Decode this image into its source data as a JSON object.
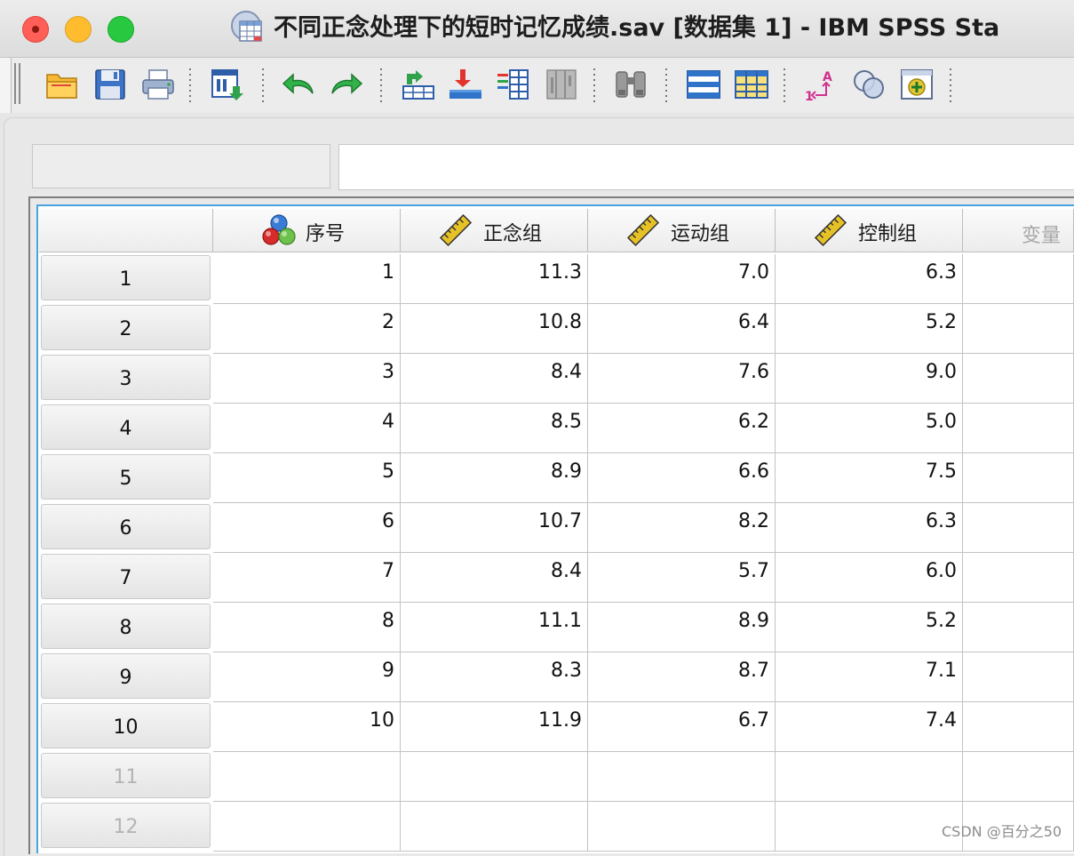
{
  "window": {
    "title": "不同正念处理下的短时记忆成绩.sav [数据集 1] - IBM SPSS Sta"
  },
  "toolbar": {
    "buttons": [
      {
        "name": "open-data-button",
        "icon": "folder-open-icon"
      },
      {
        "name": "save-button",
        "icon": "floppy-icon"
      },
      {
        "name": "print-button",
        "icon": "printer-icon"
      },
      {
        "name": "recall-dialog-button",
        "icon": "dialog-recall-icon"
      },
      {
        "name": "undo-button",
        "icon": "undo-arrow-icon"
      },
      {
        "name": "redo-button",
        "icon": "redo-arrow-icon"
      },
      {
        "name": "goto-case-button",
        "icon": "goto-case-icon"
      },
      {
        "name": "goto-variable-button",
        "icon": "goto-variable-icon"
      },
      {
        "name": "variables-button",
        "icon": "variables-list-icon"
      },
      {
        "name": "run-descriptives-button",
        "icon": "descriptives-icon"
      },
      {
        "name": "find-button",
        "icon": "binoculars-icon"
      },
      {
        "name": "insert-cases-button",
        "icon": "insert-cases-icon"
      },
      {
        "name": "insert-variable-button",
        "icon": "insert-variable-icon"
      },
      {
        "name": "value-labels-button",
        "icon": "value-labels-icon"
      },
      {
        "name": "use-sets-button",
        "icon": "variable-sets-icon"
      },
      {
        "name": "show-all-variables-button",
        "icon": "show-variables-icon"
      }
    ]
  },
  "colors": {
    "accent_blue": "#4aa3df",
    "scale_ruler": "#e7c227",
    "nominal_red": "#d62b2b",
    "nominal_blue": "#3a7bd5",
    "nominal_green": "#6cc24a"
  },
  "grid": {
    "columns": [
      {
        "label": "序号",
        "measure_icon": "nominal-measure-icon"
      },
      {
        "label": "正念组",
        "measure_icon": "scale-ruler-icon"
      },
      {
        "label": "运动组",
        "measure_icon": "scale-ruler-icon"
      },
      {
        "label": "控制组",
        "measure_icon": "scale-ruler-icon"
      },
      {
        "label": "变量",
        "measure_icon": ""
      }
    ],
    "rows": [
      {
        "num": "1",
        "cells": [
          "1",
          "11.3",
          "7.0",
          "6.3",
          ""
        ]
      },
      {
        "num": "2",
        "cells": [
          "2",
          "10.8",
          "6.4",
          "5.2",
          ""
        ]
      },
      {
        "num": "3",
        "cells": [
          "3",
          "8.4",
          "7.6",
          "9.0",
          ""
        ]
      },
      {
        "num": "4",
        "cells": [
          "4",
          "8.5",
          "6.2",
          "5.0",
          ""
        ]
      },
      {
        "num": "5",
        "cells": [
          "5",
          "8.9",
          "6.6",
          "7.5",
          ""
        ]
      },
      {
        "num": "6",
        "cells": [
          "6",
          "10.7",
          "8.2",
          "6.3",
          ""
        ]
      },
      {
        "num": "7",
        "cells": [
          "7",
          "8.4",
          "5.7",
          "6.0",
          ""
        ]
      },
      {
        "num": "8",
        "cells": [
          "8",
          "11.1",
          "8.9",
          "5.2",
          ""
        ]
      },
      {
        "num": "9",
        "cells": [
          "9",
          "8.3",
          "8.7",
          "7.1",
          ""
        ]
      },
      {
        "num": "10",
        "cells": [
          "10",
          "11.9",
          "6.7",
          "7.4",
          ""
        ]
      },
      {
        "num": "11",
        "cells": [
          "",
          "",
          "",
          "",
          ""
        ]
      },
      {
        "num": "12",
        "cells": [
          "",
          "",
          "",
          "",
          ""
        ]
      }
    ]
  },
  "watermark": "CSDN @百分之50"
}
